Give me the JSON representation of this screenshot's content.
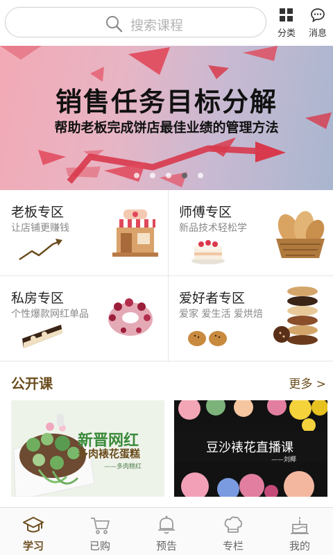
{
  "search": {
    "placeholder": "搜索课程"
  },
  "top_actions": [
    {
      "label": "分类",
      "icon": "grid-icon"
    },
    {
      "label": "消息",
      "icon": "message-icon"
    }
  ],
  "banner": {
    "title": "销售任务目标分解",
    "subtitle": "帮助老板完成饼店最佳业绩的管理方法",
    "slide_count": 5,
    "active_slide": 4
  },
  "zones": [
    {
      "title": "老板专区",
      "subtitle": "让店铺更赚钱"
    },
    {
      "title": "师傅专区",
      "subtitle": "新品技术轻松学"
    },
    {
      "title": "私房专区",
      "subtitle": "个性爆款网红单品"
    },
    {
      "title": "爱好者专区",
      "subtitle": "爱家 爱生活 爱烘焙"
    }
  ],
  "section": {
    "title": "公开课",
    "more": "更多 >"
  },
  "courses": [
    {
      "title": "新晋网红",
      "subtitle": "多肉裱花蛋糕",
      "author": "——多肉糕红"
    },
    {
      "title": "豆沙裱花直播课",
      "author": "——刘椰"
    }
  ],
  "nav": [
    {
      "label": "学习",
      "icon": "graduation-cap-icon",
      "active": true
    },
    {
      "label": "已购",
      "icon": "cart-icon",
      "active": false
    },
    {
      "label": "预告",
      "icon": "bell-icon",
      "active": false
    },
    {
      "label": "专栏",
      "icon": "chef-hat-icon",
      "active": false
    },
    {
      "label": "我的",
      "icon": "cake-icon",
      "active": false
    }
  ],
  "colors": {
    "accent": "#6b4d1e",
    "banner_red": "#e0485a",
    "border": "#cfcfcf"
  }
}
